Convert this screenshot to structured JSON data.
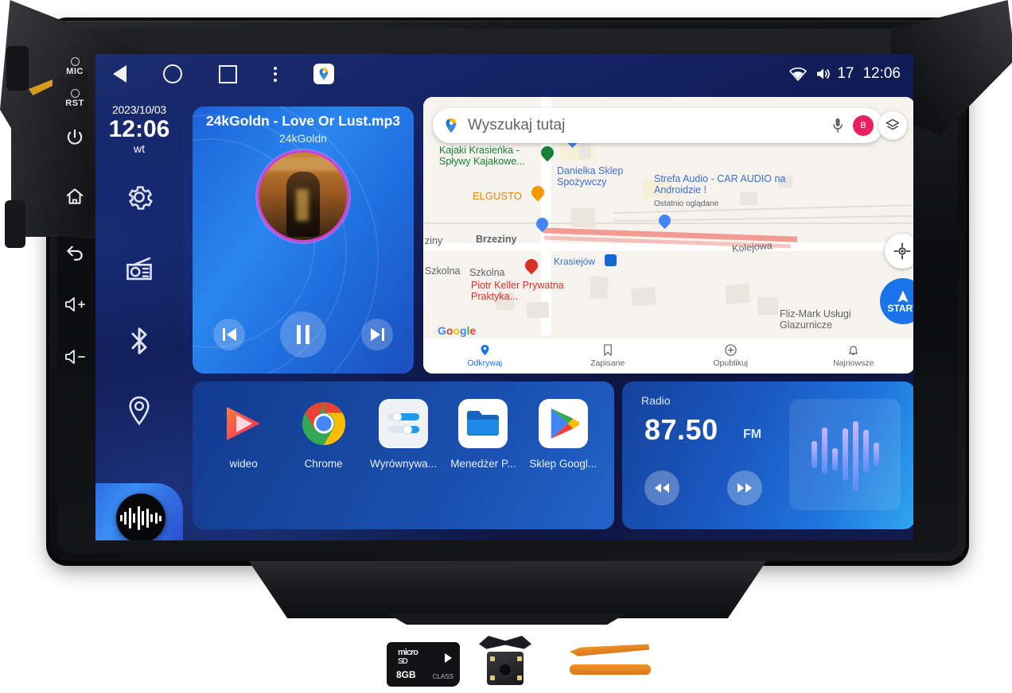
{
  "device": {
    "bezel_buttons": [
      {
        "name": "mic",
        "label": "MIC"
      },
      {
        "name": "reset",
        "label": "RST"
      },
      {
        "name": "power",
        "label": ""
      },
      {
        "name": "home",
        "label": ""
      },
      {
        "name": "back",
        "label": ""
      },
      {
        "name": "volume-up",
        "label": ""
      },
      {
        "name": "volume-down",
        "label": ""
      }
    ]
  },
  "statusbar": {
    "nav": [
      {
        "name": "back",
        "icon": "back-triangle-icon"
      },
      {
        "name": "home",
        "icon": "home-circle-icon"
      },
      {
        "name": "recents",
        "icon": "recents-square-icon"
      },
      {
        "name": "overflow",
        "icon": "more-vertical-icon"
      },
      {
        "name": "maps-shortcut",
        "icon": "google-maps-icon"
      }
    ],
    "wifi_icon": "wifi-icon",
    "volume_icon": "volume-icon",
    "volume_level": "17",
    "time": "12:06"
  },
  "rail": {
    "date": "2023/10/03",
    "time": "12:06",
    "weekday": "wt",
    "items": [
      {
        "name": "settings",
        "icon": "gear-icon"
      },
      {
        "name": "radio",
        "icon": "radio-icon"
      },
      {
        "name": "bluetooth",
        "icon": "bluetooth-icon"
      },
      {
        "name": "navigation",
        "icon": "location-pin-icon"
      }
    ],
    "assistant_icon": "sound-wave-icon"
  },
  "music": {
    "title": "24kGoldn - Love Or Lust.mp3",
    "artist": "24kGoldn",
    "controls": {
      "previous": "skip-previous-icon",
      "pause": "pause-icon",
      "next": "skip-next-icon"
    }
  },
  "maps": {
    "search_placeholder": "Wyszukaj tutaj",
    "logo_icon": "google-maps-icon",
    "mic_icon": "microphone-icon",
    "avatar_letter": "B",
    "layers_icon": "layers-icon",
    "recenter_icon": "recenter-icon",
    "start_label": "START",
    "watermark": "Google",
    "pois": [
      {
        "label": "Kajaki Krasieńka - Spływy Kajakowe...",
        "color": "#188038"
      },
      {
        "label": "Danielka Sklep Spożywczy",
        "color": "#3c6fd0"
      },
      {
        "label": "Strefa Audio - CAR AUDIO na Androidzie !",
        "sub": "Ostatnio oglądane",
        "color": "#3c6fd0"
      },
      {
        "label": "ELGUSTO",
        "color": "#e8820c"
      },
      {
        "label": "Piotr Keller Prywatna Praktyka...",
        "color": "#d93025"
      },
      {
        "label": "Krasiejów",
        "color": "#3c6fd0"
      },
      {
        "label": "Fliz-Mark Usługi Glazurnicze",
        "color": "#5f6368"
      }
    ],
    "streets": [
      "Brzeziny",
      "ziny",
      "Szkolna",
      "Szkolna",
      "Kolejowa"
    ],
    "bottom_nav": [
      {
        "label": "Odkrywaj",
        "icon": "explore-pin-icon",
        "active": true
      },
      {
        "label": "Zapisane",
        "icon": "bookmark-icon",
        "active": false
      },
      {
        "label": "Opublikuj",
        "icon": "plus-circle-icon",
        "active": false
      },
      {
        "label": "Najnowsze",
        "icon": "bell-icon",
        "active": false
      }
    ]
  },
  "apps": [
    {
      "label": "wideo",
      "icon": "video-player-icon"
    },
    {
      "label": "Chrome",
      "icon": "chrome-icon"
    },
    {
      "label": "Wyrównywa...",
      "icon": "equalizer-icon"
    },
    {
      "label": "Menedżer P...",
      "icon": "file-manager-icon"
    },
    {
      "label": "Sklep Googl...",
      "icon": "play-store-icon"
    }
  ],
  "radio": {
    "label": "Radio",
    "frequency": "87.50",
    "band": "FM",
    "prev_icon": "rewind-icon",
    "next_icon": "fast-forward-icon",
    "visual_icon": "equalizer-bars-icon"
  },
  "accessories": [
    {
      "name": "microsd-card",
      "line1": "micro",
      "line2": "SD",
      "capacity": "8GB",
      "class_label": "CLASS"
    },
    {
      "name": "rear-camera",
      "label": ""
    },
    {
      "name": "pry-tools",
      "label": ""
    }
  ],
  "colors": {
    "screen_blue": "#16266a",
    "accent": "#2a86ee",
    "maps_blue": "#1a73e8",
    "radio_cyan": "#2ea7f0"
  }
}
